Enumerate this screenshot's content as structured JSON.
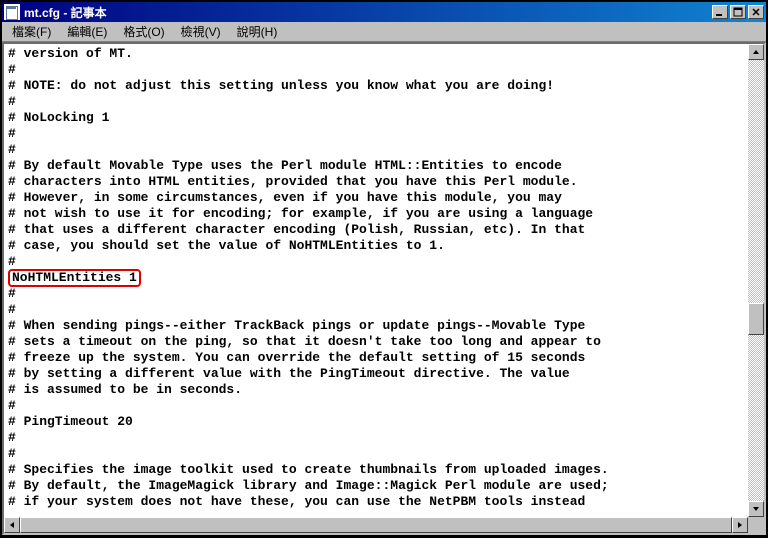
{
  "window": {
    "title": "mt.cfg - 記事本"
  },
  "menu": {
    "file": "檔案(F)",
    "edit": "編輯(E)",
    "format": "格式(O)",
    "view": "檢視(V)",
    "help": "說明(H)"
  },
  "highlight_text": "NoHTMLEntities 1",
  "lines": [
    "# version of MT.",
    "#",
    "# NOTE: do not adjust this setting unless you know what you are doing!",
    "#",
    "# NoLocking 1",
    "#",
    "#",
    "# By default Movable Type uses the Perl module HTML::Entities to encode",
    "# characters into HTML entities, provided that you have this Perl module.",
    "# However, in some circumstances, even if you have this module, you may",
    "# not wish to use it for encoding; for example, if you are using a language",
    "# that uses a different character encoding (Polish, Russian, etc). In that",
    "# case, you should set the value of NoHTMLEntities to 1.",
    "#",
    "__HIGHLIGHT__",
    "#",
    "#",
    "# When sending pings--either TrackBack pings or update pings--Movable Type",
    "# sets a timeout on the ping, so that it doesn't take too long and appear to",
    "# freeze up the system. You can override the default setting of 15 seconds",
    "# by setting a different value with the PingTimeout directive. The value",
    "# is assumed to be in seconds.",
    "#",
    "# PingTimeout 20",
    "#",
    "#",
    "# Specifies the image toolkit used to create thumbnails from uploaded images.",
    "# By default, the ImageMagick library and Image::Magick Perl module are used;",
    "# if your system does not have these, you can use the NetPBM tools instead"
  ]
}
